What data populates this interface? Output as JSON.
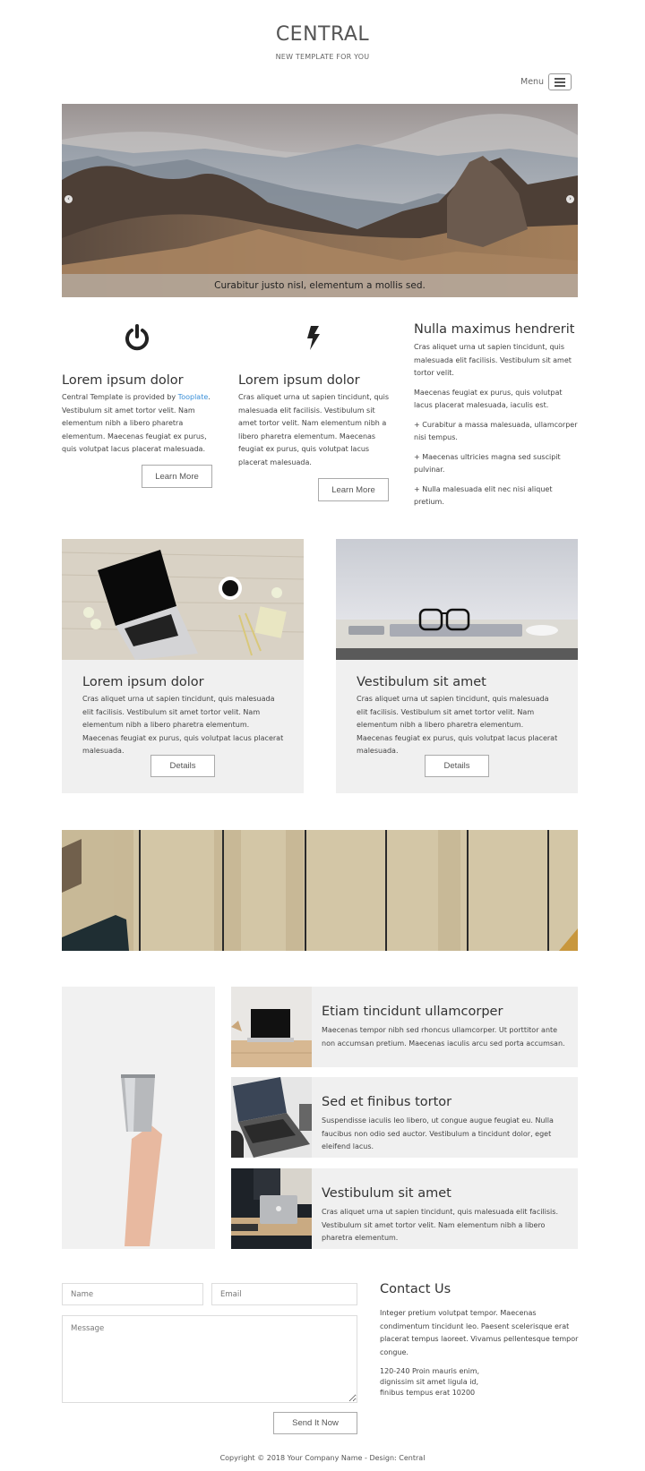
{
  "header": {
    "title": "CENTRAL",
    "tagline": "NEW TEMPLATE FOR YOU",
    "menu_label": "Menu",
    "menu_icon": "hamburger-icon"
  },
  "hero": {
    "caption": "Curabitur justo nisl, elementum a mollis sed.",
    "prev_icon": "chevron-left-icon",
    "next_icon": "chevron-right-icon",
    "image": "mountain-landscape"
  },
  "intro": {
    "columns": [
      {
        "icon": "power-icon",
        "title": "Lorem ipsum dolor",
        "text_before_link": "Central Template is provided by ",
        "link_text": "Tooplate",
        "text_after_link": ". Vestibulum sit amet tortor velit. Nam elementum nibh a libero pharetra elementum. Maecenas feugiat ex purus, quis volutpat lacus placerat malesuada.",
        "button": "Learn More"
      },
      {
        "icon": "bolt-icon",
        "title": "Lorem ipsum dolor",
        "text": "Cras aliquet urna ut sapien tincidunt, quis malesuada elit facilisis. Vestibulum sit amet tortor velit. Nam elementum nibh a libero pharetra elementum. Maecenas feugiat ex purus, quis volutpat lacus placerat malesuada.",
        "button": "Learn More"
      },
      {
        "title": "Nulla maximus hendrerit",
        "paragraphs": [
          "Cras aliquet urna ut sapien tincidunt, quis malesuada elit facilisis. Vestibulum sit amet tortor velit.",
          "Maecenas feugiat ex purus, quis volutpat lacus placerat malesuada, iaculis est.",
          "+ Curabitur a massa malesuada, ullamcorper nisi tempus.",
          "+ Maecenas ultricies magna sed suscipit pulvinar.",
          "+ Nulla malesuada elit nec nisi aliquet pretium."
        ]
      }
    ]
  },
  "cards": [
    {
      "image": "laptop-on-wooden-desk",
      "title": "Lorem ipsum dolor",
      "text": "Cras aliquet urna ut sapien tincidunt, quis malesuada elit facilisis. Vestibulum sit amet tortor velit. Nam elementum nibh a libero pharetra elementum. Maecenas feugiat ex purus, quis volutpat lacus placerat malesuada.",
      "button": "Details"
    },
    {
      "image": "glasses-on-closed-laptop",
      "title": "Vestibulum sit amet",
      "text": "Cras aliquet urna ut sapien tincidunt, quis malesuada elit facilisis. Vestibulum sit amet tortor velit. Nam elementum nibh a libero pharetra elementum. Maecenas feugiat ex purus, quis volutpat lacus placerat malesuada.",
      "button": "Details"
    }
  ],
  "banner": {
    "image": "wooden-planks-with-glasses"
  },
  "featured": {
    "side_image": "hand-holding-steel-cup",
    "items": [
      {
        "image": "laptop-on-cabinet",
        "title": "Etiam tincidunt ullamcorper",
        "text": "Maecenas tempor nibh sed rhoncus ullamcorper. Ut porttitor ante non accumsan pretium. Maecenas iaculis arcu sed porta accumsan."
      },
      {
        "image": "laptop-with-coffee",
        "title": "Sed et finibus tortor",
        "text": "Suspendisse iaculis leo libero, ut congue augue feugiat eu. Nulla faucibus non odio sed auctor. Vestibulum a tincidunt dolor, eget eleifend lacus."
      },
      {
        "image": "laptop-on-sofa-table",
        "title": "Vestibulum sit amet",
        "text": "Cras aliquet urna ut sapien tincidunt, quis malesuada elit facilisis. Vestibulum sit amet tortor velit. Nam elementum nibh a libero pharetra elementum."
      }
    ]
  },
  "contact": {
    "form": {
      "name_placeholder": "Name",
      "name_value": "",
      "email_placeholder": "Email",
      "email_value": "",
      "message_placeholder": "Message",
      "message_value": "",
      "submit": "Send It Now"
    },
    "title": "Contact Us",
    "text": "Integer pretium volutpat tempor. Maecenas condimentum tincidunt leo. Paesent scelerisque erat placerat tempus laoreet. Vivamus pellentesque tempor congue.",
    "address": [
      "120-240 Proin mauris enim,",
      "dignissim sit amet ligula id,",
      "finibus tempus erat 10200"
    ]
  },
  "footer": {
    "copyright": "Copyright © 2018 Your Company Name - Design: Central"
  },
  "colors": {
    "link": "#3a8fd8",
    "card_bg": "#f0f0f0",
    "text": "#333333"
  }
}
